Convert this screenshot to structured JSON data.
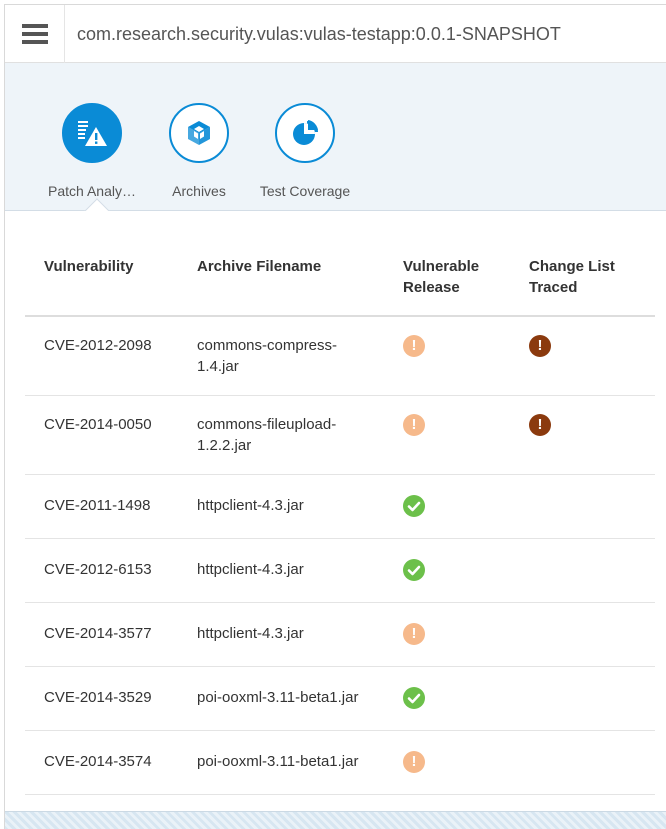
{
  "header": {
    "title": "com.research.security.vulas:vulas-testapp:0.0.1-SNAPSHOT"
  },
  "tabs": [
    {
      "label": "Patch Analy…",
      "icon": "patch-analysis-icon",
      "selected": true
    },
    {
      "label": "Archives",
      "icon": "archives-icon",
      "selected": false
    },
    {
      "label": "Test Coverage",
      "icon": "test-coverage-icon",
      "selected": false
    }
  ],
  "table": {
    "columns": [
      "Vulnerability",
      "Archive Filename",
      "Vulnerable Release",
      "Change List Traced"
    ],
    "rows": [
      {
        "vuln": "CVE-2012-2098",
        "archive": "commons-compress-1.4.jar",
        "release": "warning",
        "traced": "error"
      },
      {
        "vuln": "CVE-2014-0050",
        "archive": "commons-fileupload-1.2.2.jar",
        "release": "warning",
        "traced": "error"
      },
      {
        "vuln": "CVE-2011-1498",
        "archive": "httpclient-4.3.jar",
        "release": "ok",
        "traced": ""
      },
      {
        "vuln": "CVE-2012-6153",
        "archive": "httpclient-4.3.jar",
        "release": "ok",
        "traced": ""
      },
      {
        "vuln": "CVE-2014-3577",
        "archive": "httpclient-4.3.jar",
        "release": "warning",
        "traced": ""
      },
      {
        "vuln": "CVE-2014-3529",
        "archive": "poi-ooxml-3.11-beta1.jar",
        "release": "ok",
        "traced": ""
      },
      {
        "vuln": "CVE-2014-3574",
        "archive": "poi-ooxml-3.11-beta1.jar",
        "release": "warning",
        "traced": ""
      }
    ]
  },
  "colors": {
    "accent": "#0a8bd6",
    "warning": "#f6b98b",
    "error": "#8b3a0e",
    "ok": "#6cc04a"
  }
}
